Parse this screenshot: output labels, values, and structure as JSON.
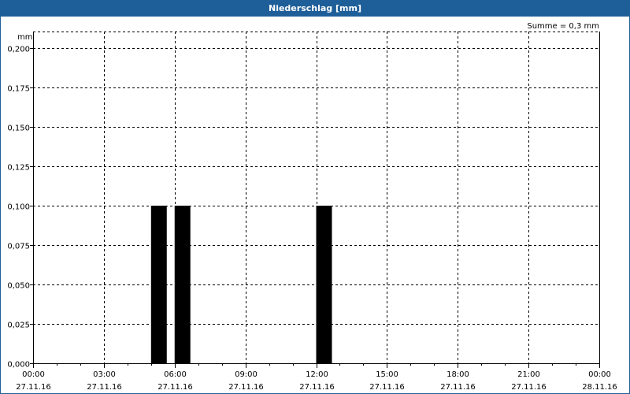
{
  "window": {
    "title": "Niederschlag [mm]"
  },
  "colors": {
    "titlebar": "#1f5f99",
    "bar": "#000000",
    "grid": "#000000"
  },
  "chart_data": {
    "type": "bar",
    "title": "Niederschlag [mm]",
    "ylabel": "mm",
    "annotation": "Summe = 0,3 mm",
    "xlim_hours": [
      0,
      24
    ],
    "ylim": [
      0,
      0.2
    ],
    "grid": true,
    "yticks": [
      {
        "value": 0,
        "label": "0,000"
      },
      {
        "value": 0.025,
        "label": "0,025"
      },
      {
        "value": 0.05,
        "label": "0,050"
      },
      {
        "value": 0.075,
        "label": "0,075"
      },
      {
        "value": 0.1,
        "label": "0,100"
      },
      {
        "value": 0.125,
        "label": "0,125"
      },
      {
        "value": 0.15,
        "label": "0,150"
      },
      {
        "value": 0.175,
        "label": "0,175"
      },
      {
        "value": 0.2,
        "label": "0,200"
      }
    ],
    "xticks": [
      {
        "hour": 0,
        "time": "00:00",
        "date": "27.11.16"
      },
      {
        "hour": 3,
        "time": "03:00",
        "date": "27.11.16"
      },
      {
        "hour": 6,
        "time": "06:00",
        "date": "27.11.16"
      },
      {
        "hour": 9,
        "time": "09:00",
        "date": "27.11.16"
      },
      {
        "hour": 12,
        "time": "12:00",
        "date": "27.11.16"
      },
      {
        "hour": 15,
        "time": "15:00",
        "date": "27.11.16"
      },
      {
        "hour": 18,
        "time": "18:00",
        "date": "27.11.16"
      },
      {
        "hour": 21,
        "time": "21:00",
        "date": "27.11.16"
      },
      {
        "hour": 24,
        "time": "00:00",
        "date": "28.11.16"
      }
    ],
    "bars": [
      {
        "start_hour": 5.0,
        "end_hour": 5.667,
        "value": 0.1
      },
      {
        "start_hour": 6.0,
        "end_hour": 6.667,
        "value": 0.1
      },
      {
        "start_hour": 12.0,
        "end_hour": 12.667,
        "value": 0.1
      }
    ]
  }
}
